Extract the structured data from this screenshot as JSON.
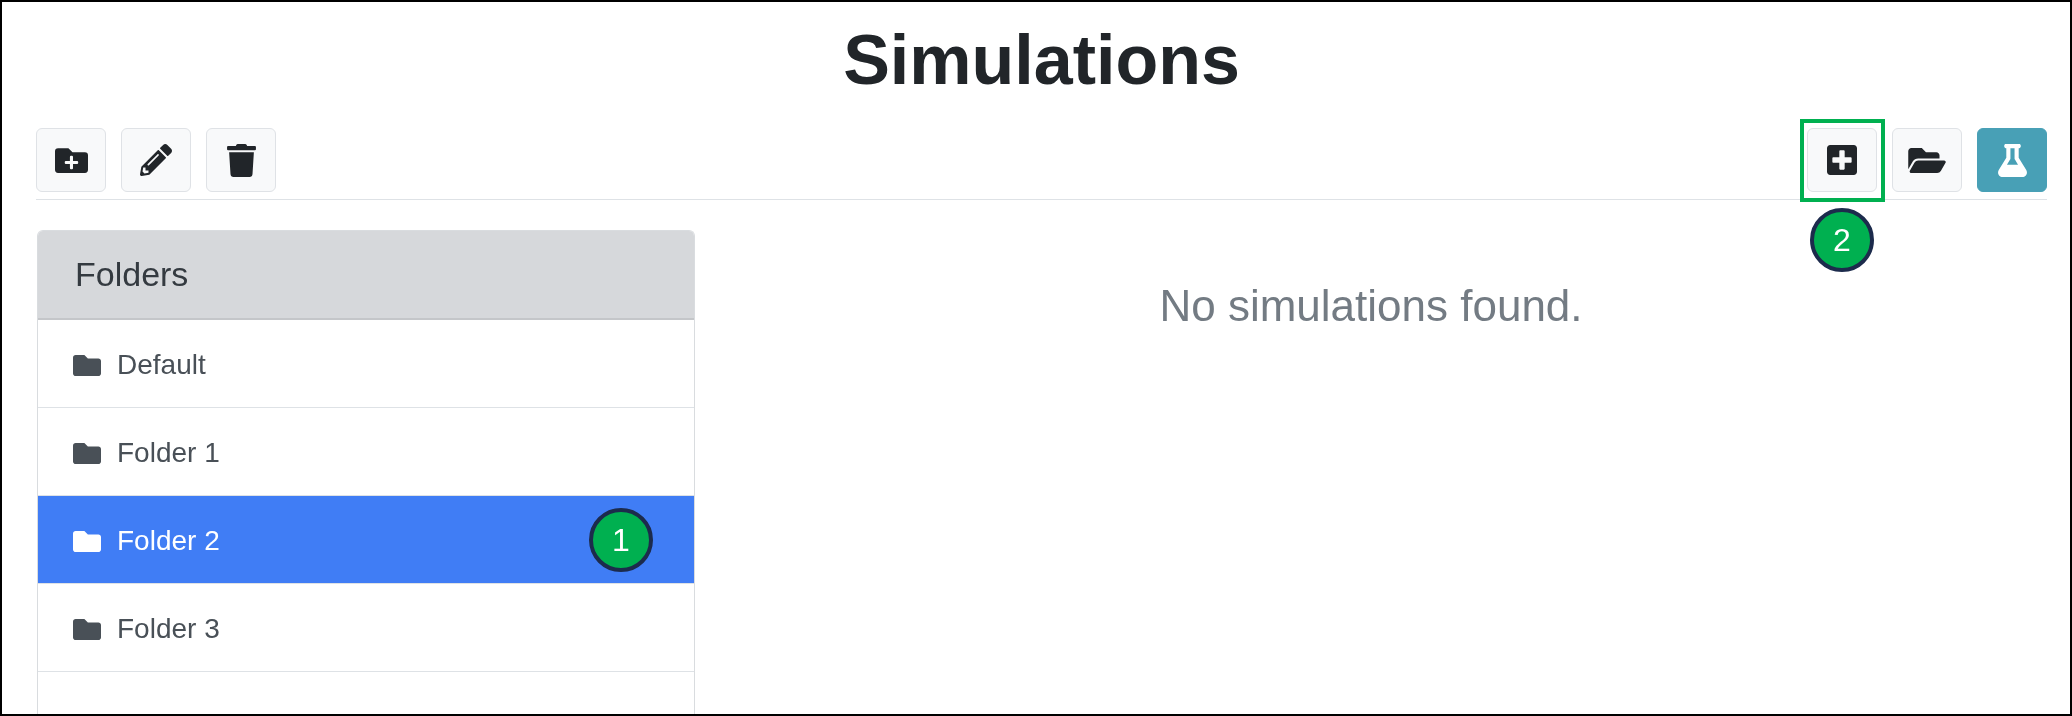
{
  "page": {
    "title": "Simulations"
  },
  "toolbar": {
    "left": [
      {
        "kind": "addfolder"
      },
      {
        "kind": "edit"
      },
      {
        "kind": "delete"
      }
    ],
    "right": [
      {
        "kind": "add",
        "active": false,
        "highlighted": true,
        "callout": "2"
      },
      {
        "kind": "open",
        "active": false,
        "highlighted": false
      },
      {
        "kind": "flask",
        "active": true,
        "highlighted": false
      }
    ]
  },
  "folders": {
    "title": "Folders",
    "items": [
      {
        "label": "Default",
        "selected": false
      },
      {
        "label": "Folder 1",
        "selected": false
      },
      {
        "label": "Folder 2",
        "selected": true,
        "callout": "1"
      },
      {
        "label": "Folder 3",
        "selected": false
      }
    ]
  },
  "main": {
    "message": "No simulations found."
  }
}
